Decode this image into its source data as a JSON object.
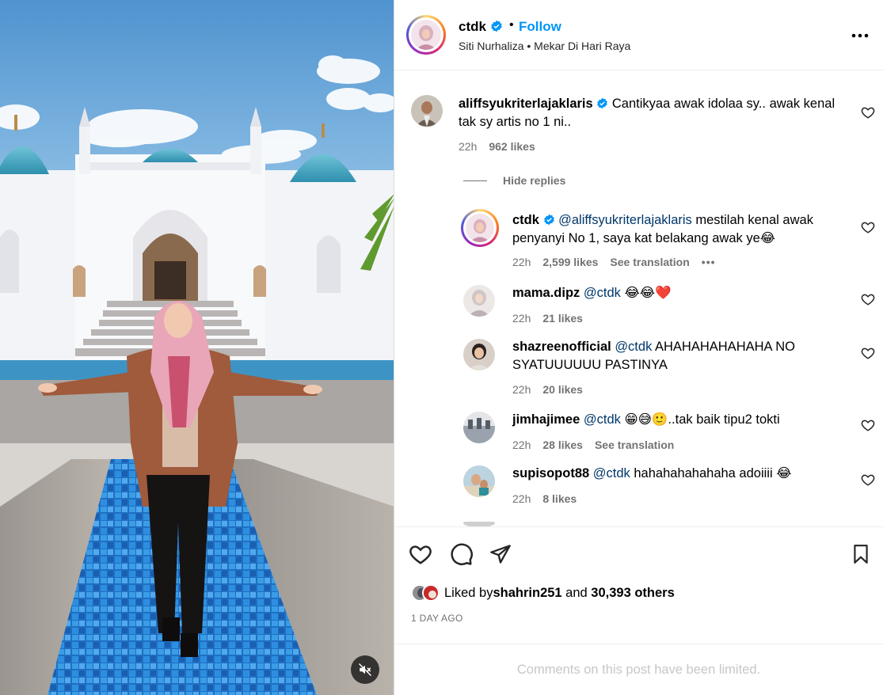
{
  "post": {
    "author": "ctdk",
    "separator": "•",
    "follow_label": "Follow",
    "audio": "Siti Nurhaliza • Mekar Di Hari Raya",
    "more_icon": "more-horizontal-icon"
  },
  "comments": [
    {
      "user": "aliffsyukriterlajaklaris",
      "verified": true,
      "text": "Cantikyaa awak idolaa sy.. awak kenal tak sy artis no 1 ni..",
      "time": "22h",
      "likes": "962 likes"
    }
  ],
  "hide_replies_label": "Hide replies",
  "replies": [
    {
      "user": "ctdk",
      "verified": true,
      "mention": "@aliffsyukriterlajaklaris",
      "text": " mestilah kenal awak penyanyi No 1, saya kat belakang awak ye😂",
      "time": "22h",
      "likes": "2,599 likes",
      "see_translation": "See translation",
      "more": "•••"
    },
    {
      "user": "mama.dipz",
      "mention": "@ctdk",
      "text": " 😂😂❤️",
      "time": "22h",
      "likes": "21 likes"
    },
    {
      "user": "shazreenofficial",
      "mention": "@ctdk",
      "text": " AHAHAHAHAHAHA NO SYATUUUUUU PASTINYA",
      "time": "22h",
      "likes": "20 likes"
    },
    {
      "user": "jimhajimee",
      "mention": "@ctdk",
      "text": " 😁😅🙂..tak baik tipu2 tokti",
      "time": "22h",
      "likes": "28 likes",
      "see_translation": "See translation"
    },
    {
      "user": "supisopot88",
      "mention": "@ctdk",
      "text": " hahahahahahaha adoiiii 😂",
      "time": "22h",
      "likes": "8 likes"
    }
  ],
  "actions": {
    "like_icon": "heart-icon",
    "comment_icon": "comment-icon",
    "share_icon": "send-icon",
    "save_icon": "bookmark-icon"
  },
  "liked_by": {
    "prefix": "Liked by ",
    "user": "shahrin251",
    "middle": " and ",
    "others": "30,393 others"
  },
  "time_ago": "1 DAY AGO",
  "comments_limited": "Comments on this post have been limited.",
  "colors": {
    "accent": "#0095f6",
    "verified": "#0095f6",
    "mention": "#00376b",
    "muted": "#737373",
    "heart_red": "#ed4956"
  }
}
